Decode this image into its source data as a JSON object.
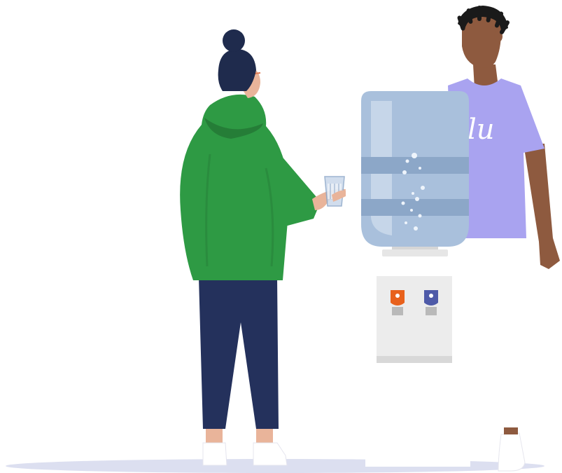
{
  "illustration": {
    "shirt_logo": "lu",
    "colors": {
      "background": "#ffffff",
      "floor": "#dcdff0",
      "hoodie": "#2e9a44",
      "hoodie_shadow": "#257d37",
      "pants": "#24315c",
      "hair": "#1f2b4d",
      "skin_light": "#e9b49a",
      "skin_dark": "#8e5a3f",
      "tshirt": "#a9a3f0",
      "jug": "#a9c0dc",
      "jug_highlight": "#c9d8ea",
      "dispenser_body": "#ececec",
      "hot_tap": "#e8611c",
      "cold_tap": "#4e5aa8",
      "shoes": "#ffffff"
    },
    "icons": [
      "water-cooler-icon",
      "cup-icon",
      "hot-tap-icon",
      "cold-tap-icon"
    ]
  }
}
